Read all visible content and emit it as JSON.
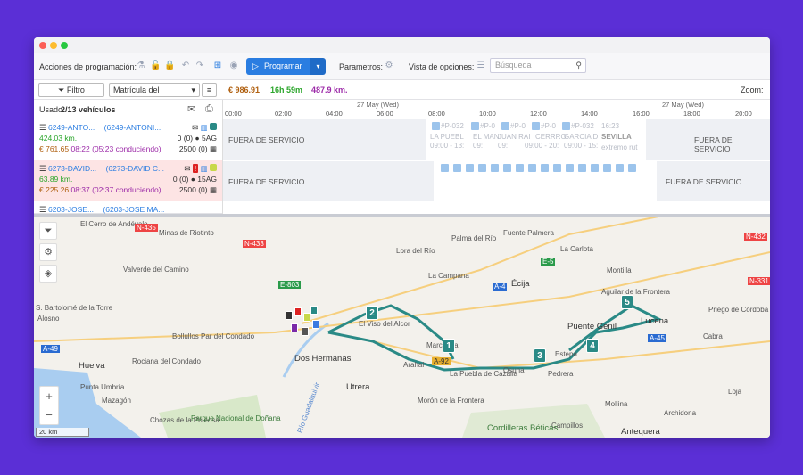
{
  "toolbar": {
    "acciones_label": "Acciones de programación:",
    "programar_label": "Programar",
    "parametros_label": "Parametros:",
    "vista_label": "Vista de opciones:",
    "search_placeholder": "Búsqueda"
  },
  "filterbar": {
    "filtro_label": "Filtro",
    "sort_select": "Matrícula del",
    "cost": "€ 986.91",
    "time": "16h 59m",
    "distance": "487.9 km.",
    "zoom_label": "Zoom:"
  },
  "vehicles": {
    "used_label": "Usado",
    "used_count": "2/13 vehículos",
    "rows": [
      {
        "name": "6249-ANTO...",
        "code": "(6249-ANTONI...",
        "km": "424.03 km.",
        "cost": "€ 761.65",
        "time": "08:22 (05:23 conduciendo)",
        "cap1": "0 (0) ● 5AG",
        "cap2": "2500 (0)"
      },
      {
        "name": "6273-DAVID...",
        "code": "(6273-DAVID C...",
        "km": "63.89 km.",
        "cost": "€ 225.26",
        "time": "08:37 (02:37 conduciendo)",
        "cap1": "0 (0) ● 15AG",
        "cap2": "2500 (0)"
      },
      {
        "name": "6203-JOSE...",
        "code": "(6203-JOSE MA..."
      }
    ]
  },
  "timeline": {
    "date_a": "27 May (Wed)",
    "date_b": "27 May (Wed)",
    "hours": [
      "00:00",
      "02:00",
      "04:00",
      "06:00",
      "08:00",
      "10:00",
      "12:00",
      "14:00",
      "16:00",
      "18:00",
      "20:00"
    ],
    "out_of_service": "FUERA DE SERVICIO",
    "lane1_tasks": [
      "#P-032",
      "#P-0",
      "#P-0",
      "#P-0",
      "#P-032"
    ],
    "lane1_text": [
      "LA PUEBL",
      "EL MAN",
      "JUAN RAI",
      "CERRRO",
      "GARCIA D"
    ],
    "lane1_times": [
      "09:00 - 13:",
      "09:",
      "09:",
      "09:00 - 20:",
      "09:00 - 15:"
    ],
    "lane1_end": "16:23",
    "lane1_end_place": "SEVILLA",
    "lane1_end_note": "extremo rut"
  },
  "map": {
    "scale": "20 km",
    "places": [
      "El Cerro de Andévalo",
      "Minas de Riotinto",
      "Valverde del Camino",
      "S. Bartolomé de la Torre",
      "Bollullos Par del Condado",
      "Rociana del Condado",
      "Huelva",
      "Punta Umbría",
      "Mazagón",
      "Chozas de la Poleosa",
      "Parque Nacional de Doñana",
      "Dos Hermanas",
      "Utrera",
      "Lora del Río",
      "La Campana",
      "Palma del Río",
      "Fuente Palmera",
      "La Carlota",
      "Écija",
      "El Viso del Alcor",
      "Marchena",
      "Arahal",
      "La Puebla de Cazalla",
      "Osuna",
      "Morón de la Frontera",
      "Pedrera",
      "Estepa",
      "Puente Genil",
      "Lucena",
      "Montilla",
      "Aguilar de la Frontera",
      "Priego de Córdoba",
      "Mollina",
      "Archidona",
      "Antequera",
      "Campillos",
      "Loja",
      "Cabra",
      "Cordilleras Béticas",
      "Alosno",
      "Río Guadalquivir"
    ],
    "stops": [
      "1",
      "2",
      "3",
      "4",
      "5"
    ],
    "roads": [
      "N-435",
      "N-433",
      "A-49",
      "A-4",
      "E-5",
      "E-803",
      "A-92",
      "N-432",
      "A-45",
      "N-331"
    ]
  }
}
